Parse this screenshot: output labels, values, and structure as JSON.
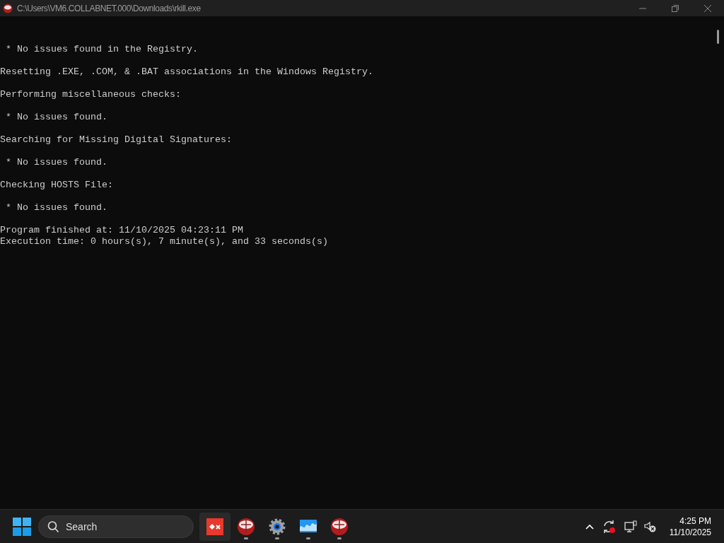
{
  "window": {
    "title": "C:\\Users\\VM6.COLLABNET.000\\Downloads\\rkill.exe"
  },
  "console": {
    "blocks": [
      [
        " * No issues found in the Registry."
      ],
      [
        "Resetting .EXE, .COM, & .BAT associations in the Windows Registry."
      ],
      [
        "Performing miscellaneous checks:"
      ],
      [
        " * No issues found."
      ],
      [
        "Searching for Missing Digital Signatures:"
      ],
      [
        " * No issues found."
      ],
      [
        "Checking HOSTS File:"
      ],
      [
        " * No issues found."
      ],
      [
        "Program finished at: 11/10/2025 04:23:11 PM",
        "Execution time: 0 hours(s), 7 minute(s), and 33 seconds(s)"
      ]
    ]
  },
  "taskbar": {
    "search": {
      "placeholder": "Search"
    },
    "apps": [
      {
        "kind": "tool",
        "running": false,
        "selected": true
      },
      {
        "kind": "rkill",
        "running": true,
        "selected": false
      },
      {
        "kind": "settings",
        "running": true,
        "selected": false
      },
      {
        "kind": "monitor",
        "running": true,
        "selected": false
      },
      {
        "kind": "rkill",
        "running": true,
        "selected": false
      }
    ],
    "clock": {
      "time": "4:25 PM",
      "date": "11/10/2025"
    }
  }
}
